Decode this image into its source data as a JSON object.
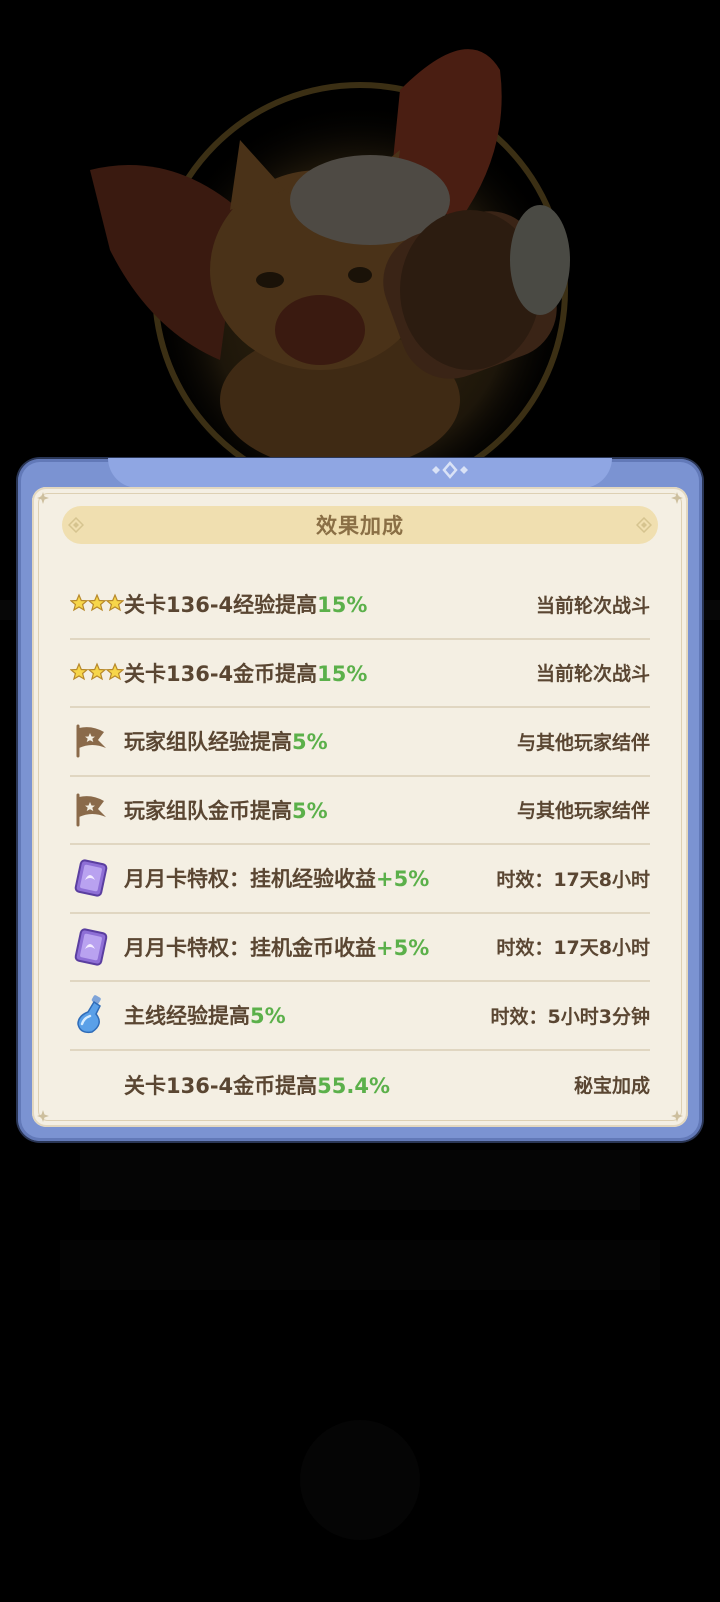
{
  "panel": {
    "title": "效果加成",
    "rows": [
      {
        "icon": "three-stars-icon",
        "text": "关卡136-4经验提高",
        "value": "15%",
        "right": "当前轮次战斗"
      },
      {
        "icon": "three-stars-icon",
        "text": "关卡136-4金币提高",
        "value": "15%",
        "right": "当前轮次战斗"
      },
      {
        "icon": "team-flag-icon",
        "text": "玩家组队经验提高",
        "value": "5%",
        "right": "与其他玩家结伴"
      },
      {
        "icon": "team-flag-icon",
        "text": "玩家组队金币提高",
        "value": "5%",
        "right": "与其他玩家结伴"
      },
      {
        "icon": "monthly-card-icon",
        "text": "月月卡特权：挂机经验收益",
        "value": "+5%",
        "right": "时效：17天8小时"
      },
      {
        "icon": "monthly-card-icon",
        "text": "月月卡特权：挂机金币收益",
        "value": "+5%",
        "right": "时效：17天8小时"
      },
      {
        "icon": "potion-icon",
        "text": "主线经验提高",
        "value": "5%",
        "right": "时效：5小时3分钟"
      },
      {
        "icon": "",
        "text": "关卡136-4金币提高",
        "value": "55.4%",
        "right": "秘宝加成"
      }
    ]
  },
  "colors": {
    "highlight": "#5bb04a",
    "text": "#5a4632",
    "panel_frame": "#7b93d2",
    "panel_bg": "#f4efe3",
    "header_bg": "#f0dfb0"
  }
}
